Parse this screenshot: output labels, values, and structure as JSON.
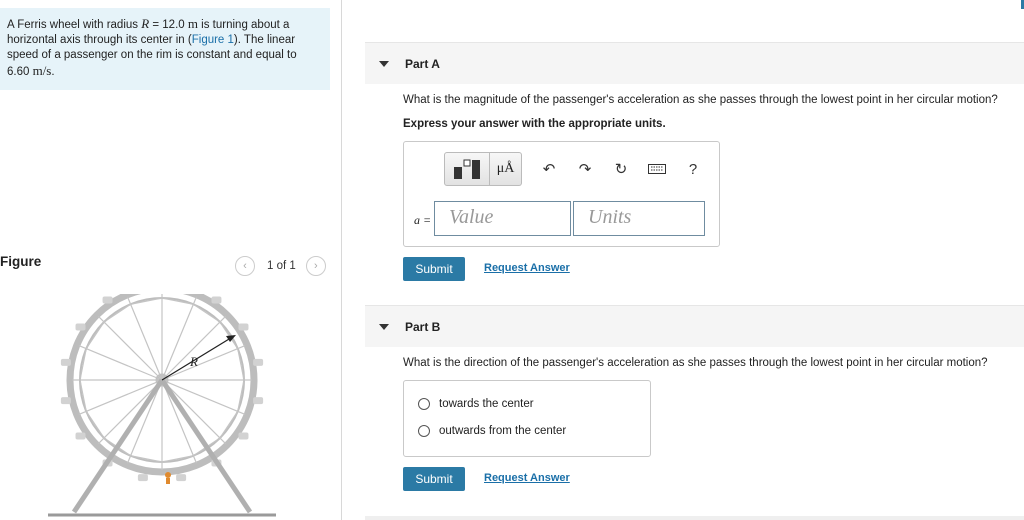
{
  "problem": {
    "text_1": "A Ferris wheel with radius ",
    "var_R": "R",
    "text_2": " = 12.0 ",
    "unit_m": "m",
    "text_3": " is turning about a horizontal axis through its center in (",
    "figure_link": "Figure 1",
    "text_4": "). The linear speed of a passenger on the rim is constant and equal to ",
    "speed": "6.60 ",
    "speed_unit": "m/s",
    "text_5": "."
  },
  "figure": {
    "header": "Figure",
    "counter": "1 of 1",
    "prev_icon": "chevron-left-icon",
    "next_icon": "chevron-right-icon",
    "radius_label": "R"
  },
  "part_a": {
    "title": "Part A",
    "question": "What is the magnitude of the passenger's acceleration as she passes through the lowest point in her circular motion?",
    "instruction": "Express your answer with the appropriate units.",
    "toolbar": {
      "units_btn": "μÅ",
      "help": "?"
    },
    "var_label": "a =",
    "value_placeholder": "Value",
    "units_placeholder": "Units",
    "submit": "Submit",
    "request": "Request Answer"
  },
  "part_b": {
    "title": "Part B",
    "question": "What is the direction of the passenger's acceleration as she passes through the lowest point in her circular motion?",
    "options": [
      "towards the center",
      "outwards from the center"
    ],
    "submit": "Submit",
    "request": "Request Answer"
  },
  "colors": {
    "accent": "#2b7aa5",
    "link": "#1a6fa8",
    "problem_bg": "#e6f3f9",
    "part_header_bg": "#f5f5f5"
  }
}
